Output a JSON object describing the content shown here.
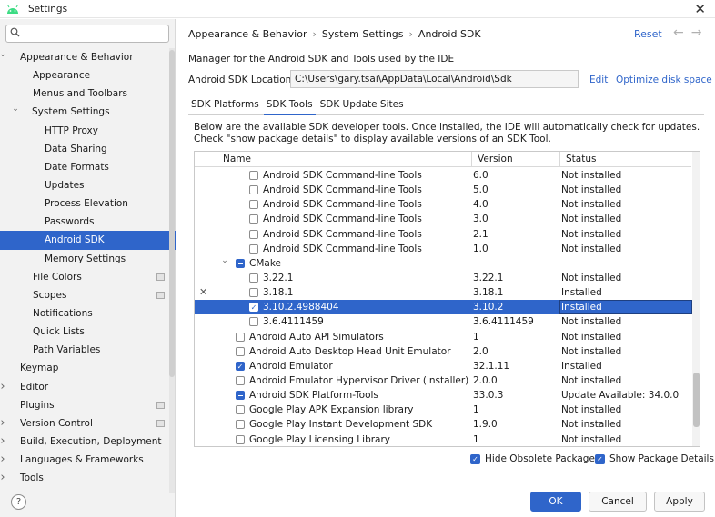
{
  "window": {
    "title": "Settings",
    "close_glyph": "✕"
  },
  "sidebar": {
    "search_placeholder": "",
    "items": [
      {
        "label": "Appearance & Behavior",
        "indent": 0,
        "arrow": "⌄",
        "bold": true
      },
      {
        "label": "Appearance",
        "indent": 2
      },
      {
        "label": "Menus and Toolbars",
        "indent": 2
      },
      {
        "label": "System Settings",
        "indent": 1,
        "arrow": "⌄"
      },
      {
        "label": "HTTP Proxy",
        "indent": 3
      },
      {
        "label": "Data Sharing",
        "indent": 3
      },
      {
        "label": "Date Formats",
        "indent": 3
      },
      {
        "label": "Updates",
        "indent": 3
      },
      {
        "label": "Process Elevation",
        "indent": 3
      },
      {
        "label": "Passwords",
        "indent": 3
      },
      {
        "label": "Android SDK",
        "indent": 3,
        "selected": true
      },
      {
        "label": "Memory Settings",
        "indent": 3
      },
      {
        "label": "File Colors",
        "indent": 2,
        "mark": true
      },
      {
        "label": "Scopes",
        "indent": 2,
        "mark": true
      },
      {
        "label": "Notifications",
        "indent": 2
      },
      {
        "label": "Quick Lists",
        "indent": 2
      },
      {
        "label": "Path Variables",
        "indent": 2
      },
      {
        "label": "Keymap",
        "indent": 0
      },
      {
        "label": "Editor",
        "indent": 0,
        "arrow": "›"
      },
      {
        "label": "Plugins",
        "indent": 0,
        "mark": true
      },
      {
        "label": "Version Control",
        "indent": 0,
        "arrow": "›",
        "mark": true
      },
      {
        "label": "Build, Execution, Deployment",
        "indent": 0,
        "arrow": "›"
      },
      {
        "label": "Languages & Frameworks",
        "indent": 0,
        "arrow": "›"
      },
      {
        "label": "Tools",
        "indent": 0,
        "arrow": "›"
      }
    ],
    "help_label": "?"
  },
  "header": {
    "breadcrumb": [
      "Appearance & Behavior",
      "System Settings",
      "Android SDK"
    ],
    "breadcrumb_sep": "›",
    "reset_label": "Reset",
    "back_glyph": "←",
    "forward_glyph": "→"
  },
  "description": "Manager for the Android SDK and Tools used by the IDE",
  "sdk_location": {
    "label": "Android SDK Location:",
    "value": "C:\\Users\\gary.tsai\\AppData\\Local\\Android\\Sdk",
    "edit_label": "Edit",
    "optimize_label": "Optimize disk space"
  },
  "tabs": [
    {
      "label": "SDK Platforms",
      "active": false
    },
    {
      "label": "SDK Tools",
      "active": true
    },
    {
      "label": "SDK Update Sites",
      "active": false
    }
  ],
  "info_lines": [
    "Below are the available SDK developer tools. Once installed, the IDE will automatically check for updates.",
    "Check \"show package details\" to display available versions of an SDK Tool."
  ],
  "table": {
    "columns": [
      "Name",
      "Version",
      "Status"
    ],
    "rows": [
      {
        "name": "Android SDK Command-line Tools",
        "version": "6.0",
        "status": "Not installed",
        "level": 2,
        "check": "none"
      },
      {
        "name": "Android SDK Command-line Tools",
        "version": "5.0",
        "status": "Not installed",
        "level": 2,
        "check": "none"
      },
      {
        "name": "Android SDK Command-line Tools",
        "version": "4.0",
        "status": "Not installed",
        "level": 2,
        "check": "none"
      },
      {
        "name": "Android SDK Command-line Tools",
        "version": "3.0",
        "status": "Not installed",
        "level": 2,
        "check": "none"
      },
      {
        "name": "Android SDK Command-line Tools",
        "version": "2.1",
        "status": "Not installed",
        "level": 2,
        "check": "none"
      },
      {
        "name": "Android SDK Command-line Tools",
        "version": "1.0",
        "status": "Not installed",
        "level": 2,
        "check": "none"
      },
      {
        "name": "CMake",
        "version": "",
        "status": "",
        "level": 1,
        "check": "partial",
        "expanded": true
      },
      {
        "name": "3.22.1",
        "version": "3.22.1",
        "status": "Not installed",
        "level": 2,
        "check": "none"
      },
      {
        "name": "3.18.1",
        "version": "3.18.1",
        "status": "Installed",
        "level": 2,
        "check": "none",
        "x_mark": true
      },
      {
        "name": "3.10.2.4988404",
        "version": "3.10.2",
        "status": "Installed",
        "level": 2,
        "check": "checked",
        "selected": true
      },
      {
        "name": "3.6.4111459",
        "version": "3.6.4111459",
        "status": "Not installed",
        "level": 2,
        "check": "none"
      },
      {
        "name": "Android Auto API Simulators",
        "version": "1",
        "status": "Not installed",
        "level": 1,
        "check": "none"
      },
      {
        "name": "Android Auto Desktop Head Unit Emulator",
        "version": "2.0",
        "status": "Not installed",
        "level": 1,
        "check": "none"
      },
      {
        "name": "Android Emulator",
        "version": "32.1.11",
        "status": "Installed",
        "level": 1,
        "check": "checked"
      },
      {
        "name": "Android Emulator Hypervisor Driver (installer)",
        "version": "2.0.0",
        "status": "Not installed",
        "level": 1,
        "check": "none"
      },
      {
        "name": "Android SDK Platform-Tools",
        "version": "33.0.3",
        "status": "Update Available: 34.0.0",
        "level": 1,
        "check": "partial"
      },
      {
        "name": "Google Play APK Expansion library",
        "version": "1",
        "status": "Not installed",
        "level": 1,
        "check": "none"
      },
      {
        "name": "Google Play Instant Development SDK",
        "version": "1.9.0",
        "status": "Not installed",
        "level": 1,
        "check": "none"
      },
      {
        "name": "Google Play Licensing Library",
        "version": "1",
        "status": "Not installed",
        "level": 1,
        "check": "none"
      }
    ]
  },
  "options": {
    "hide_obsolete": "Hide Obsolete Packages",
    "show_details": "Show Package Details"
  },
  "footer": {
    "ok_label": "OK",
    "cancel_label": "Cancel",
    "apply_label": "Apply"
  }
}
